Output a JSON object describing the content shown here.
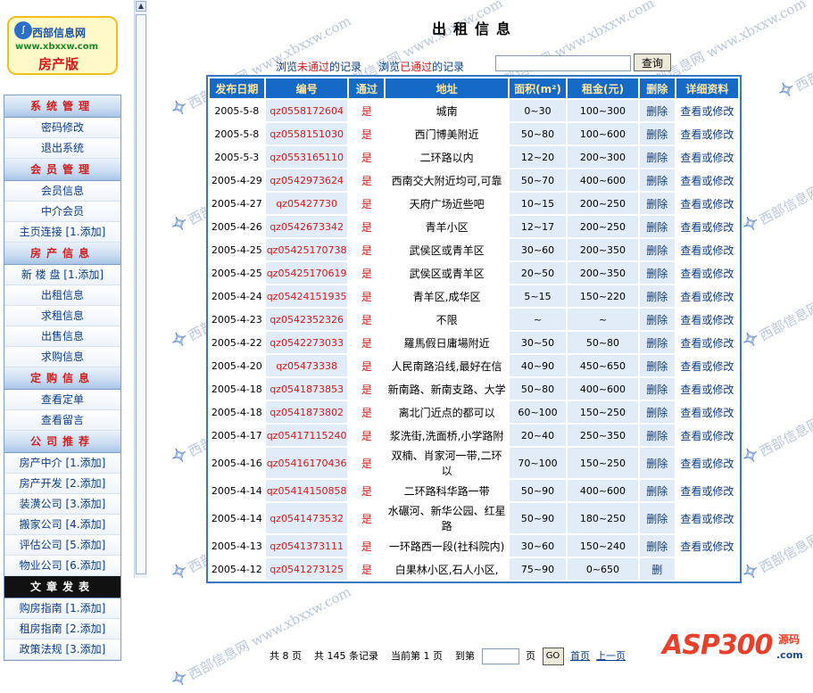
{
  "logo": {
    "line1": "西部信息网",
    "line2": "www.xbxxw.com",
    "line3": "房产版",
    "watermark": "西部信息网 www.xbxxw.com"
  },
  "menu": [
    {
      "type": "header",
      "label": "系统管理"
    },
    {
      "type": "item",
      "label": "密码修改"
    },
    {
      "type": "item",
      "label": "退出系统"
    },
    {
      "type": "header",
      "label": "会员管理"
    },
    {
      "type": "item",
      "label": "会员信息"
    },
    {
      "type": "item",
      "label": "中介会员"
    },
    {
      "type": "item",
      "label": "主页连接 [1.添加]"
    },
    {
      "type": "header",
      "label": "房产信息"
    },
    {
      "type": "item",
      "label": "新 楼 盘 [1.添加]"
    },
    {
      "type": "item",
      "label": "出租信息"
    },
    {
      "type": "item",
      "label": "求租信息"
    },
    {
      "type": "item",
      "label": "出售信息"
    },
    {
      "type": "item",
      "label": "求购信息"
    },
    {
      "type": "header",
      "label": "定购信息"
    },
    {
      "type": "item",
      "label": "查看定单"
    },
    {
      "type": "item",
      "label": "查看留言"
    },
    {
      "type": "header",
      "label": "公司推荐"
    },
    {
      "type": "item",
      "label": "房产中介 [1.添加]"
    },
    {
      "type": "item",
      "label": "房产开发 [2.添加]"
    },
    {
      "type": "item",
      "label": "装潢公司 [3.添加]"
    },
    {
      "type": "item",
      "label": "搬家公司 [4.添加]"
    },
    {
      "type": "item",
      "label": "评估公司 [5.添加]"
    },
    {
      "type": "item",
      "label": "物业公司 [6.添加]"
    },
    {
      "type": "header-dark",
      "label": "文章发表"
    },
    {
      "type": "item",
      "label": "购房指南 [1.添加]"
    },
    {
      "type": "item",
      "label": "租房指南 [2.添加]"
    },
    {
      "type": "item",
      "label": "政策法规 [3.添加]"
    }
  ],
  "page": {
    "title": "出租信息",
    "links": {
      "unpassed_a": "浏览",
      "unpassed_b": "未通过",
      "unpassed_c": "的记录",
      "passed_a": "浏览",
      "passed_b": "已通过",
      "passed_c": "的记录"
    },
    "search_button": "查询"
  },
  "table": {
    "headers": [
      "发布日期",
      "编号",
      "通过",
      "地址",
      "面积(m²)",
      "租金(元)",
      "删除",
      "详细资料"
    ],
    "rows": [
      [
        "2005-5-8",
        "qz0558172604",
        "是",
        "城南",
        "0~30",
        "100~300",
        "删除",
        "查看或修改"
      ],
      [
        "2005-5-8",
        "qz0558151030",
        "是",
        "西门博美附近",
        "50~80",
        "100~600",
        "删除",
        "查看或修改"
      ],
      [
        "2005-5-3",
        "qz0553165110",
        "是",
        "二环路以内",
        "12~20",
        "200~300",
        "删除",
        "查看或修改"
      ],
      [
        "2005-4-29",
        "qz0542973624",
        "是",
        "西南交大附近均可,可靠",
        "50~70",
        "400~600",
        "删除",
        "查看或修改"
      ],
      [
        "2005-4-27",
        "qz05427730",
        "是",
        "天府广场近些吧",
        "10~15",
        "200~250",
        "删除",
        "查看或修改"
      ],
      [
        "2005-4-26",
        "qz0542673342",
        "是",
        "青羊小区",
        "12~17",
        "200~250",
        "删除",
        "查看或修改"
      ],
      [
        "2005-4-25",
        "qz05425170738",
        "是",
        "武侯区或青羊区",
        "30~60",
        "200~350",
        "删除",
        "查看或修改"
      ],
      [
        "2005-4-25",
        "qz05425170619",
        "是",
        "武侯区或青羊区",
        "20~50",
        "200~350",
        "删除",
        "查看或修改"
      ],
      [
        "2005-4-24",
        "qz05424151935",
        "是",
        "青羊区,成华区",
        "5~15",
        "150~220",
        "删除",
        "查看或修改"
      ],
      [
        "2005-4-23",
        "qz0542352326",
        "是",
        "不限",
        "~",
        "~",
        "删除",
        "查看或修改"
      ],
      [
        "2005-4-22",
        "qz0542273033",
        "是",
        "羅馬假日庸場附近",
        "30~50",
        "50~80",
        "删除",
        "查看或修改"
      ],
      [
        "2005-4-20",
        "qz05473338",
        "是",
        "人民南路沿线,最好在信",
        "40~90",
        "450~650",
        "删除",
        "查看或修改"
      ],
      [
        "2005-4-18",
        "qz0541873853",
        "是",
        "新南路、新南支路、大学",
        "50~80",
        "400~600",
        "删除",
        "查看或修改"
      ],
      [
        "2005-4-18",
        "qz0541873802",
        "是",
        "离北门近点的都可以",
        "60~100",
        "150~250",
        "删除",
        "查看或修改"
      ],
      [
        "2005-4-17",
        "qz05417115240",
        "是",
        "浆洗街,洗面桥,小学路附",
        "20~40",
        "250~350",
        "删除",
        "查看或修改"
      ],
      [
        "2005-4-16",
        "qz05416170436",
        "是",
        "双楠、肖家河一带,二环以",
        "70~100",
        "150~250",
        "删除",
        "查看或修改"
      ],
      [
        "2005-4-14",
        "qz05414150858",
        "是",
        "二环路科华路一带",
        "50~90",
        "400~600",
        "删除",
        "查看或修改"
      ],
      [
        "2005-4-14",
        "qz0541473532",
        "是",
        "水碾河、新华公园、红星路",
        "50~90",
        "180~250",
        "删除",
        "查看或修改"
      ],
      [
        "2005-4-13",
        "qz0541373111",
        "是",
        "一环路西一段(社科院内)",
        "30~60",
        "150~240",
        "删除",
        "查看或修改"
      ],
      [
        "2005-4-12",
        "qz0541273125",
        "是",
        "白果林小区,石人小区,",
        "75~90",
        "0~650",
        "删",
        ""
      ]
    ]
  },
  "pager": {
    "pages": "共 8 页",
    "records": "共 145 条记录",
    "current": "当前第 1 页",
    "goto": "到第",
    "page_unit": "页",
    "go": "GO",
    "first": "首页",
    "prev": "上一页"
  },
  "brand": {
    "main": "ASP300",
    "sub": "源码",
    "url": ".com"
  }
}
